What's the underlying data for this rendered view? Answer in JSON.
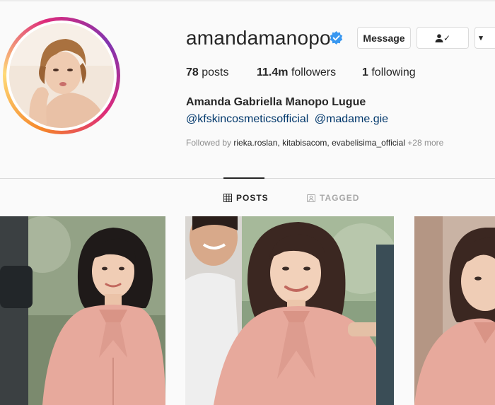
{
  "profile": {
    "username": "amandamanopo",
    "verified_icon": "verified-badge-icon",
    "full_name": "Amanda Gabriella Manopo Lugue",
    "bio_links": [
      "@kfskincosmeticsofficial",
      "@madame.gie"
    ],
    "followed_by_prefix": "Followed by",
    "followed_by_names": "rieka.roslan, kitabisacom, evabelisima_official",
    "followed_by_more": "+28 more"
  },
  "stats": {
    "posts_count": "78",
    "posts_label": "posts",
    "followers_count": "11.4m",
    "followers_label": "followers",
    "following_count": "1",
    "following_label": "following"
  },
  "actions": {
    "message_label": "Message",
    "follow_check": "✓",
    "more_icon": "▾"
  },
  "tabs": [
    {
      "label": "POSTS",
      "icon": "grid-icon",
      "active": true
    },
    {
      "label": "TAGGED",
      "icon": "tag-person-icon",
      "active": false
    }
  ],
  "colors": {
    "accent_link": "#00376b",
    "verified": "#3897f0",
    "blouse": "#e7a99c"
  }
}
